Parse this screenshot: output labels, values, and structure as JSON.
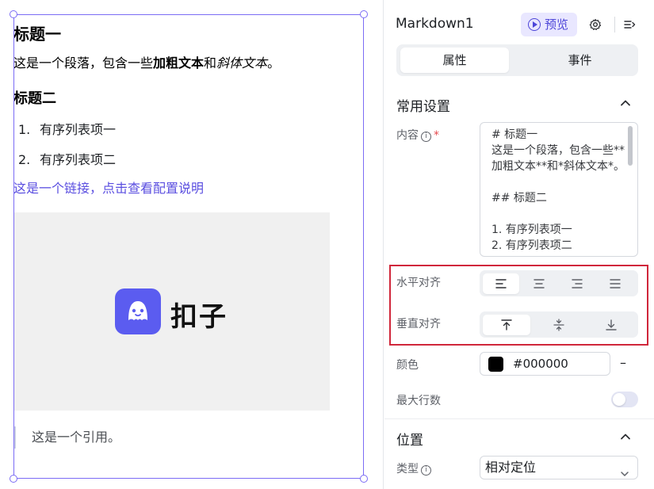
{
  "preview": {
    "h1": "标题一",
    "paragraph": {
      "pre": "这是一个段落，包含一些",
      "bold": "加粗文本",
      "mid": "和",
      "italic": "斜体文本",
      "post": "。"
    },
    "h2": "标题二",
    "list": [
      {
        "num": "1.",
        "text": "有序列表项一"
      },
      {
        "num": "2.",
        "text": "有序列表项二"
      }
    ],
    "link": "这是一个链接，点击查看配置说明",
    "image_logo_text": "扣子",
    "quote": "这是一个引用。"
  },
  "panel": {
    "title": "Markdown1",
    "preview_button": "预览",
    "tabs": [
      {
        "label": "属性",
        "active": true
      },
      {
        "label": "事件",
        "active": false
      }
    ],
    "section_common": "常用设置",
    "content_label": "内容",
    "content_value": "# 标题一\n这是一个段落，包含一些**加粗文本**和*斜体文本*。\n\n## 标题二\n\n1. 有序列表项一\n2. 有序列表项二",
    "h_align_label": "水平对齐",
    "h_align_selected": "left",
    "v_align_label": "垂直对齐",
    "v_align_selected": "top",
    "color_label": "颜色",
    "color_value": "#000000",
    "max_lines_label": "最大行数",
    "max_lines_enabled": false,
    "section_position": "位置",
    "type_label": "类型",
    "type_value": "相对定位"
  },
  "colors": {
    "accent": "#5a4ee0",
    "selection": "#7b6cf5",
    "highlight": "#d0273b",
    "logo": "#5b5cf0"
  },
  "icons": [
    "play-icon",
    "gear-icon",
    "collapse-panel-icon",
    "info-icon",
    "chevron-up-icon",
    "align-left-icon",
    "align-center-icon",
    "align-right-icon",
    "align-justify-icon",
    "align-top-icon",
    "align-middle-icon",
    "align-bottom-icon",
    "chevron-down-icon"
  ]
}
